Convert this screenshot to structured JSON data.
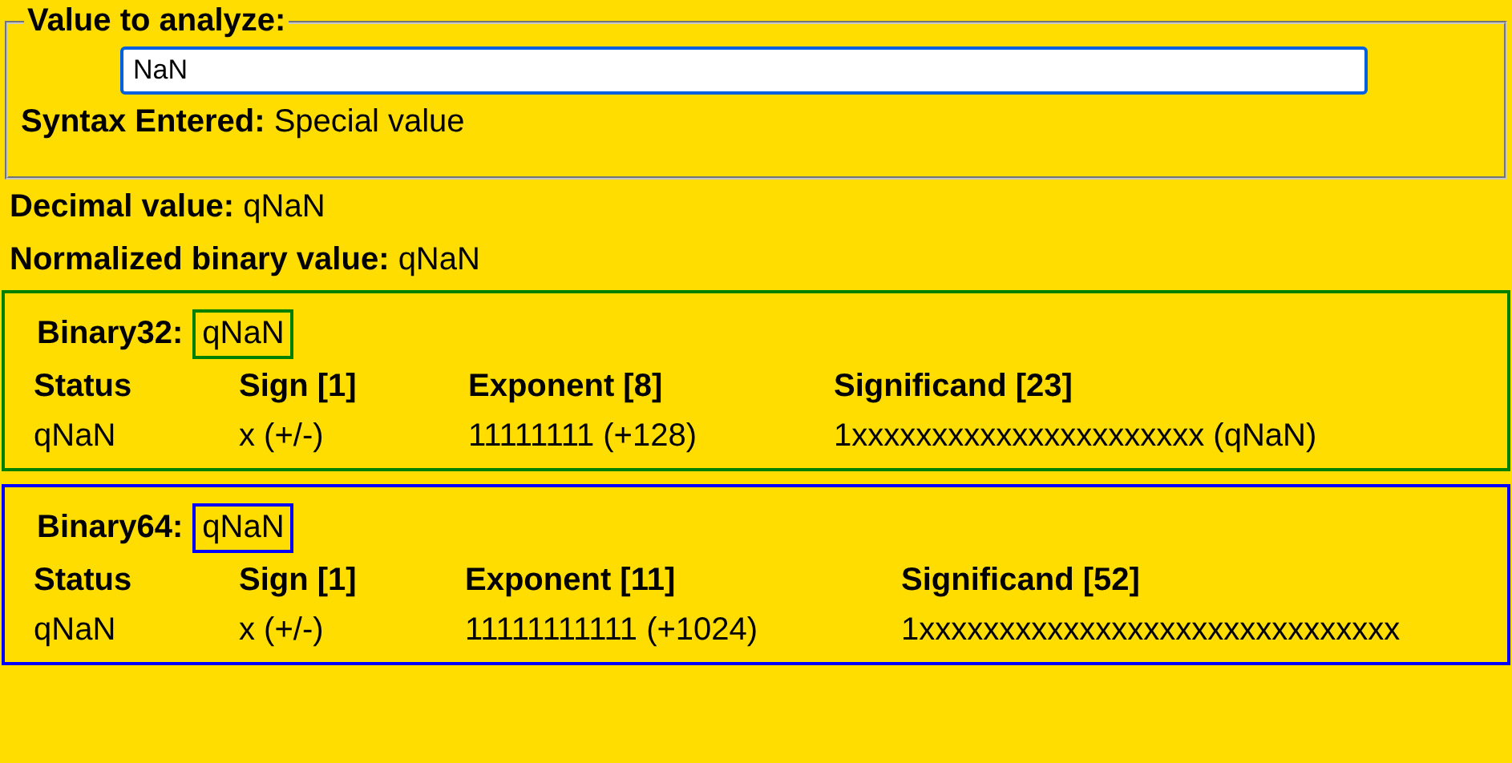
{
  "input_group": {
    "legend": "Value to analyze:",
    "field": {
      "value": "NaN"
    },
    "syntax": {
      "label": "Syntax Entered:",
      "value": "Special value"
    }
  },
  "results": [
    {
      "label": "Decimal value:",
      "value": "qNaN"
    },
    {
      "label": "Normalized binary value:",
      "value": "qNaN"
    }
  ],
  "formats": [
    {
      "name": "Binary32:",
      "value": "qNaN",
      "color": "#008000",
      "columns": [
        "Status",
        "Sign [1]",
        "Exponent [8]",
        "Significand [23]"
      ],
      "cells": [
        "qNaN",
        "x (+/-)",
        "11111111 (+128)",
        "1xxxxxxxxxxxxxxxxxxxxxx (qNaN)"
      ]
    },
    {
      "name": "Binary64:",
      "value": "qNaN",
      "color": "#0000ff",
      "columns": [
        "Status",
        "Sign [1]",
        "Exponent [11]",
        "Significand [52]"
      ],
      "cells": [
        "qNaN",
        "x (+/-)",
        "11111111111 (+1024)",
        "1xxxxxxxxxxxxxxxxxxxxxxxxxxxxxx"
      ]
    }
  ]
}
